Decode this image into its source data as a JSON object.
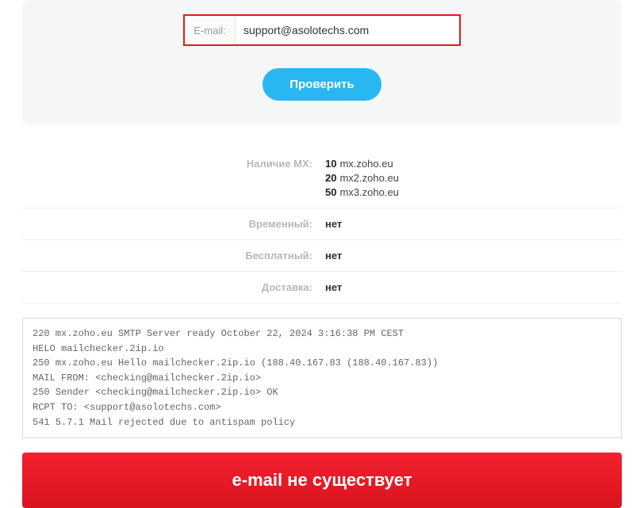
{
  "form": {
    "email_label": "E-mail:",
    "email_value": "support@asolotechs.com",
    "check_button": "Проверить"
  },
  "results": {
    "mx_label": "Наличие MX:",
    "mx_records": [
      {
        "priority": "10",
        "host": "mx.zoho.eu"
      },
      {
        "priority": "20",
        "host": "mx2.zoho.eu"
      },
      {
        "priority": "50",
        "host": "mx3.zoho.eu"
      }
    ],
    "temporary_label": "Временный:",
    "temporary_value": "нет",
    "free_label": "Бесплатный:",
    "free_value": "нет",
    "delivery_label": "Доставка:",
    "delivery_value": "нет"
  },
  "log_text": "220 mx.zoho.eu SMTP Server ready October 22, 2024 3:16:38 PM CEST\nHELO mailchecker.2ip.io\n250 mx.zoho.eu Hello mailchecker.2ip.io (188.40.167.83 (188.40.167.83))\nMAIL FROM: <checking@mailchecker.2ip.io>\n250 Sender <checking@mailchecker.2ip.io> OK\nRCPT TO: <support@asolotechs.com>\n541 5.7.1 Mail rejected due to antispam policy",
  "status_message": "e-mail не существует"
}
